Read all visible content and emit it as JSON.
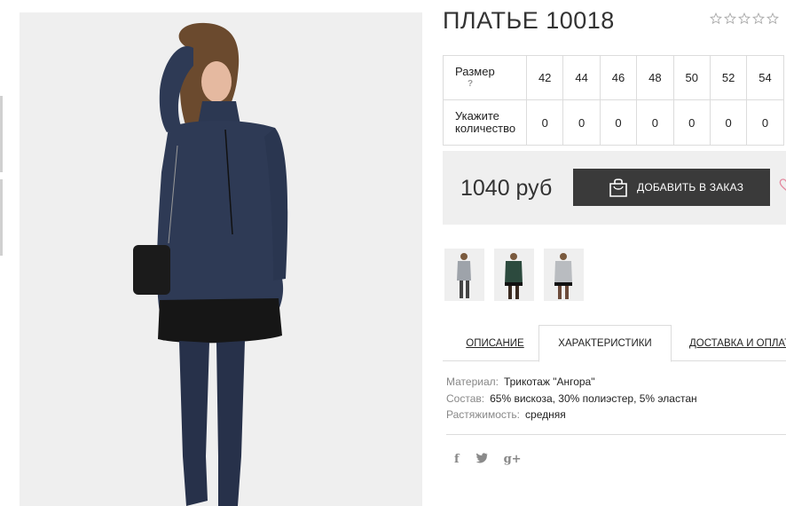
{
  "product": {
    "title": "ПЛАТЬЕ 10018",
    "rating_stars": 5,
    "rating_value": 0
  },
  "size_table": {
    "size_label": "Размер",
    "help_mark": "?",
    "qty_label": "Укажите количество",
    "sizes": [
      "42",
      "44",
      "46",
      "48",
      "50",
      "52",
      "54"
    ],
    "quantities": [
      "0",
      "0",
      "0",
      "0",
      "0",
      "0",
      "0"
    ]
  },
  "purchase": {
    "price": "1040 руб",
    "add_button_label": "ДОБАВИТЬ В ЗАКАЗ"
  },
  "tabs": {
    "items": [
      "ОПИСАНИЕ",
      "ХАРАКТЕРИСТИКИ",
      "ДОСТАВКА И ОПЛАТА"
    ],
    "active": "ХАРАКТЕРИСТИКИ"
  },
  "characteristics": {
    "material_key": "Материал:",
    "material_value": "Трикотаж \"Ангора\"",
    "composition_key": "Состав:",
    "composition_value": "65% вискоза, 30% полиэстер, 5% эластан",
    "stretch_key": "Растяжимость:",
    "stretch_value": "средняя"
  },
  "social": {
    "icons": [
      "facebook-icon",
      "twitter-icon",
      "google-plus-icon"
    ],
    "facebook": "f",
    "twitter": "t",
    "googleplus": "g+"
  },
  "colors": {
    "accent_dark": "#3a3a3a",
    "price_box_bg": "#efefef",
    "dress_main": "#2e3a55",
    "thumb_green": "#2c4a3e",
    "thumb_grey": "#b9bcc0",
    "heart": "#e58aa0"
  }
}
